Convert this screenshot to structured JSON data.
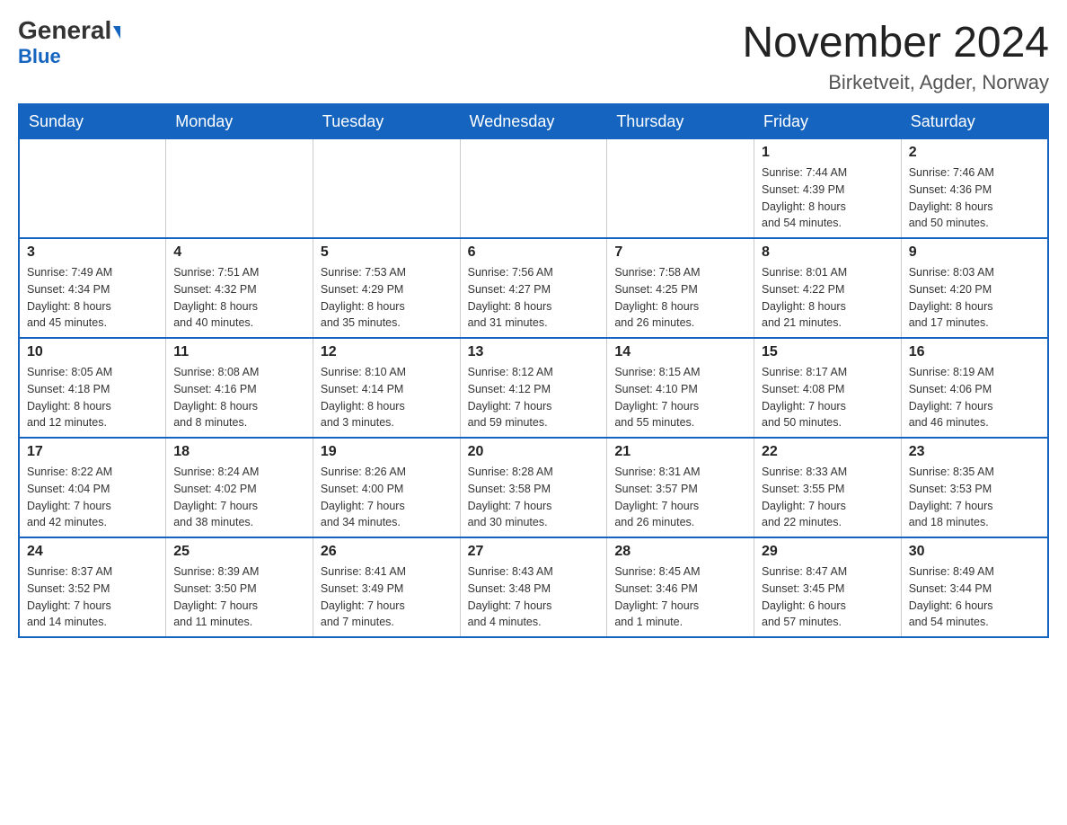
{
  "header": {
    "logo_general": "General",
    "logo_blue": "Blue",
    "month_title": "November 2024",
    "location": "Birketveit, Agder, Norway"
  },
  "weekdays": [
    "Sunday",
    "Monday",
    "Tuesday",
    "Wednesday",
    "Thursday",
    "Friday",
    "Saturday"
  ],
  "weeks": [
    [
      {
        "day": "",
        "info": ""
      },
      {
        "day": "",
        "info": ""
      },
      {
        "day": "",
        "info": ""
      },
      {
        "day": "",
        "info": ""
      },
      {
        "day": "",
        "info": ""
      },
      {
        "day": "1",
        "info": "Sunrise: 7:44 AM\nSunset: 4:39 PM\nDaylight: 8 hours\nand 54 minutes."
      },
      {
        "day": "2",
        "info": "Sunrise: 7:46 AM\nSunset: 4:36 PM\nDaylight: 8 hours\nand 50 minutes."
      }
    ],
    [
      {
        "day": "3",
        "info": "Sunrise: 7:49 AM\nSunset: 4:34 PM\nDaylight: 8 hours\nand 45 minutes."
      },
      {
        "day": "4",
        "info": "Sunrise: 7:51 AM\nSunset: 4:32 PM\nDaylight: 8 hours\nand 40 minutes."
      },
      {
        "day": "5",
        "info": "Sunrise: 7:53 AM\nSunset: 4:29 PM\nDaylight: 8 hours\nand 35 minutes."
      },
      {
        "day": "6",
        "info": "Sunrise: 7:56 AM\nSunset: 4:27 PM\nDaylight: 8 hours\nand 31 minutes."
      },
      {
        "day": "7",
        "info": "Sunrise: 7:58 AM\nSunset: 4:25 PM\nDaylight: 8 hours\nand 26 minutes."
      },
      {
        "day": "8",
        "info": "Sunrise: 8:01 AM\nSunset: 4:22 PM\nDaylight: 8 hours\nand 21 minutes."
      },
      {
        "day": "9",
        "info": "Sunrise: 8:03 AM\nSunset: 4:20 PM\nDaylight: 8 hours\nand 17 minutes."
      }
    ],
    [
      {
        "day": "10",
        "info": "Sunrise: 8:05 AM\nSunset: 4:18 PM\nDaylight: 8 hours\nand 12 minutes."
      },
      {
        "day": "11",
        "info": "Sunrise: 8:08 AM\nSunset: 4:16 PM\nDaylight: 8 hours\nand 8 minutes."
      },
      {
        "day": "12",
        "info": "Sunrise: 8:10 AM\nSunset: 4:14 PM\nDaylight: 8 hours\nand 3 minutes."
      },
      {
        "day": "13",
        "info": "Sunrise: 8:12 AM\nSunset: 4:12 PM\nDaylight: 7 hours\nand 59 minutes."
      },
      {
        "day": "14",
        "info": "Sunrise: 8:15 AM\nSunset: 4:10 PM\nDaylight: 7 hours\nand 55 minutes."
      },
      {
        "day": "15",
        "info": "Sunrise: 8:17 AM\nSunset: 4:08 PM\nDaylight: 7 hours\nand 50 minutes."
      },
      {
        "day": "16",
        "info": "Sunrise: 8:19 AM\nSunset: 4:06 PM\nDaylight: 7 hours\nand 46 minutes."
      }
    ],
    [
      {
        "day": "17",
        "info": "Sunrise: 8:22 AM\nSunset: 4:04 PM\nDaylight: 7 hours\nand 42 minutes."
      },
      {
        "day": "18",
        "info": "Sunrise: 8:24 AM\nSunset: 4:02 PM\nDaylight: 7 hours\nand 38 minutes."
      },
      {
        "day": "19",
        "info": "Sunrise: 8:26 AM\nSunset: 4:00 PM\nDaylight: 7 hours\nand 34 minutes."
      },
      {
        "day": "20",
        "info": "Sunrise: 8:28 AM\nSunset: 3:58 PM\nDaylight: 7 hours\nand 30 minutes."
      },
      {
        "day": "21",
        "info": "Sunrise: 8:31 AM\nSunset: 3:57 PM\nDaylight: 7 hours\nand 26 minutes."
      },
      {
        "day": "22",
        "info": "Sunrise: 8:33 AM\nSunset: 3:55 PM\nDaylight: 7 hours\nand 22 minutes."
      },
      {
        "day": "23",
        "info": "Sunrise: 8:35 AM\nSunset: 3:53 PM\nDaylight: 7 hours\nand 18 minutes."
      }
    ],
    [
      {
        "day": "24",
        "info": "Sunrise: 8:37 AM\nSunset: 3:52 PM\nDaylight: 7 hours\nand 14 minutes."
      },
      {
        "day": "25",
        "info": "Sunrise: 8:39 AM\nSunset: 3:50 PM\nDaylight: 7 hours\nand 11 minutes."
      },
      {
        "day": "26",
        "info": "Sunrise: 8:41 AM\nSunset: 3:49 PM\nDaylight: 7 hours\nand 7 minutes."
      },
      {
        "day": "27",
        "info": "Sunrise: 8:43 AM\nSunset: 3:48 PM\nDaylight: 7 hours\nand 4 minutes."
      },
      {
        "day": "28",
        "info": "Sunrise: 8:45 AM\nSunset: 3:46 PM\nDaylight: 7 hours\nand 1 minute."
      },
      {
        "day": "29",
        "info": "Sunrise: 8:47 AM\nSunset: 3:45 PM\nDaylight: 6 hours\nand 57 minutes."
      },
      {
        "day": "30",
        "info": "Sunrise: 8:49 AM\nSunset: 3:44 PM\nDaylight: 6 hours\nand 54 minutes."
      }
    ]
  ]
}
